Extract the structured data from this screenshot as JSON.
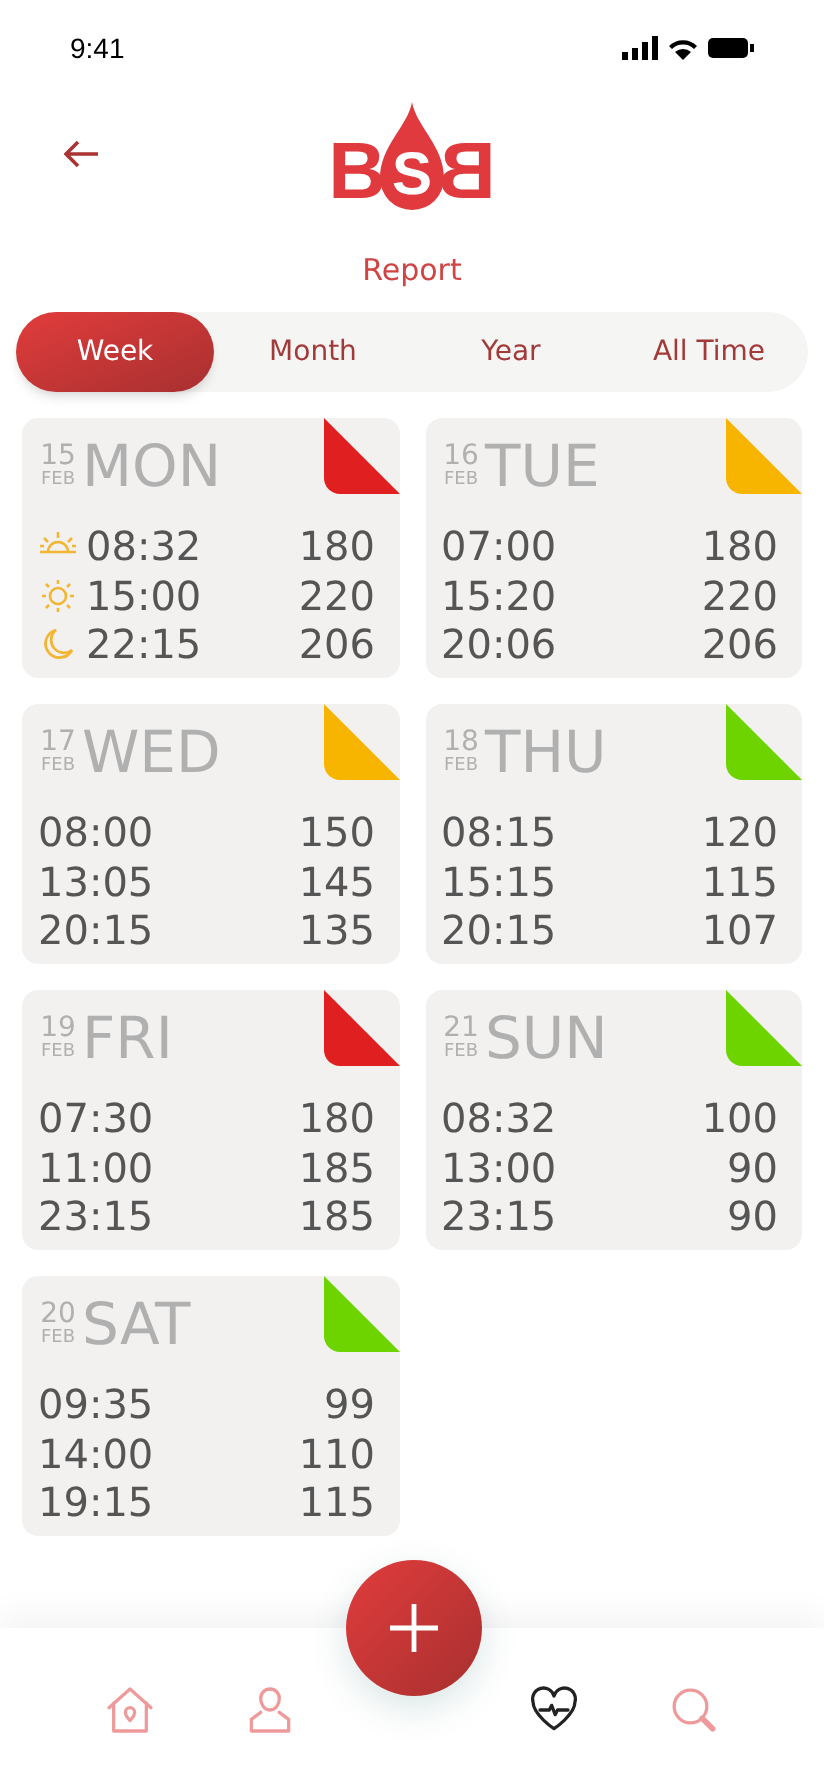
{
  "status_bar": {
    "time": "9:41"
  },
  "logo": {
    "letters": [
      "B",
      "S",
      "B"
    ]
  },
  "title": "Report",
  "tabs": [
    {
      "label": "Week",
      "selected": true
    },
    {
      "label": "Month",
      "selected": false
    },
    {
      "label": "Year",
      "selected": false
    },
    {
      "label": "All Time",
      "selected": false
    }
  ],
  "days": [
    {
      "day": "15",
      "month": "FEB",
      "weekday": "MON",
      "color": "#e02020",
      "readings": [
        {
          "time": "08:32",
          "value": "180",
          "kind": "sunrise"
        },
        {
          "time": "15:00",
          "value": "220",
          "kind": "sun"
        },
        {
          "time": "22:15",
          "value": "206",
          "kind": "moon"
        }
      ]
    },
    {
      "day": "16",
      "month": "FEB",
      "weekday": "TUE",
      "color": "#f7b500",
      "readings": [
        {
          "time": "07:00",
          "value": "180"
        },
        {
          "time": "15:20",
          "value": "220"
        },
        {
          "time": "20:06",
          "value": "206"
        }
      ]
    },
    {
      "day": "17",
      "month": "FEB",
      "weekday": "WED",
      "color": "#f7b500",
      "readings": [
        {
          "time": "08:00",
          "value": "150"
        },
        {
          "time": "13:05",
          "value": "145"
        },
        {
          "time": "20:15",
          "value": "135"
        }
      ]
    },
    {
      "day": "18",
      "month": "FEB",
      "weekday": "THU",
      "color": "#6dd400",
      "readings": [
        {
          "time": "08:15",
          "value": "120"
        },
        {
          "time": "15:15",
          "value": "115"
        },
        {
          "time": "20:15",
          "value": "107"
        }
      ]
    },
    {
      "day": "19",
      "month": "FEB",
      "weekday": "FRI",
      "color": "#e02020",
      "readings": [
        {
          "time": "07:30",
          "value": "180"
        },
        {
          "time": "11:00",
          "value": "185"
        },
        {
          "time": "23:15",
          "value": "185"
        }
      ]
    },
    {
      "day": "21",
      "month": "FEB",
      "weekday": "SUN",
      "color": "#6dd400",
      "readings": [
        {
          "time": "08:32",
          "value": "100"
        },
        {
          "time": "13:00",
          "value": "90"
        },
        {
          "time": "23:15",
          "value": "90"
        }
      ]
    },
    {
      "day": "20",
      "month": "FEB",
      "weekday": "SAT",
      "color": "#6dd400",
      "readings": [
        {
          "time": "09:35",
          "value": "99"
        },
        {
          "time": "14:00",
          "value": "110"
        },
        {
          "time": "19:15",
          "value": "115"
        }
      ]
    }
  ],
  "nav": [
    {
      "kind": "home",
      "selected": false
    },
    {
      "kind": "profile",
      "selected": false
    },
    {
      "kind": "health",
      "selected": true
    },
    {
      "kind": "search",
      "selected": false
    }
  ]
}
